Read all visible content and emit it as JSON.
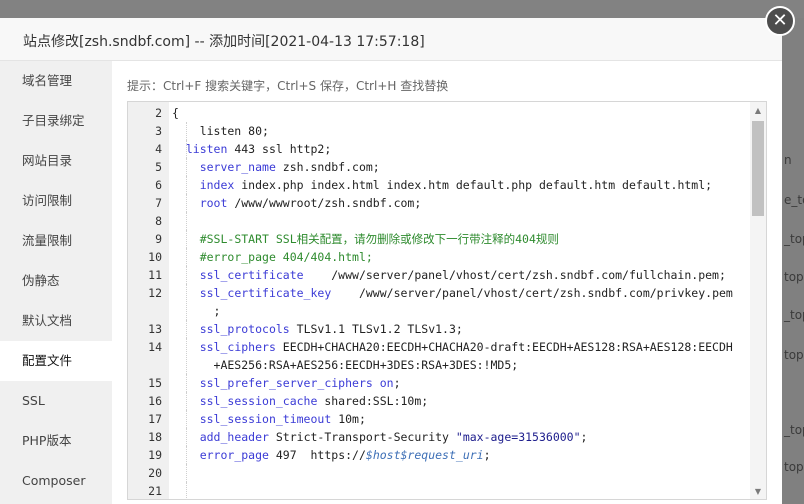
{
  "background": {
    "right_texts": [
      "n",
      "e_to",
      "_top",
      "top",
      "_top",
      "top",
      "_top",
      "top"
    ]
  },
  "dialog": {
    "title": "站点修改[zsh.sndbf.com] -- 添加时间[2021-04-13 17:57:18]",
    "close_icon": "close-icon",
    "hint": "提示：Ctrl+F 搜索关键字，Ctrl+S 保存，Ctrl+H 查找替换"
  },
  "sidebar": {
    "active_index": 7,
    "items": [
      {
        "label": "域名管理"
      },
      {
        "label": "子目录绑定"
      },
      {
        "label": "网站目录"
      },
      {
        "label": "访问限制"
      },
      {
        "label": "流量限制"
      },
      {
        "label": "伪静态"
      },
      {
        "label": "默认文档"
      },
      {
        "label": "配置文件"
      },
      {
        "label": "SSL"
      },
      {
        "label": "PHP版本"
      },
      {
        "label": "Composer"
      }
    ]
  },
  "editor": {
    "lines": [
      {
        "n": "2",
        "segs": [
          [
            "pl",
            "{"
          ]
        ]
      },
      {
        "n": "3",
        "segs": [
          [
            "pl",
            "    listen 80;"
          ]
        ]
      },
      {
        "n": "4",
        "segs": [
          [
            "pl",
            "  "
          ],
          [
            "kw",
            "listen"
          ],
          [
            "pl",
            " 443 ssl http2;"
          ]
        ]
      },
      {
        "n": "5",
        "segs": [
          [
            "pl",
            "    "
          ],
          [
            "kw",
            "server_name"
          ],
          [
            "pl",
            " zsh.sndbf.com;"
          ]
        ]
      },
      {
        "n": "6",
        "segs": [
          [
            "pl",
            "    "
          ],
          [
            "kw",
            "index"
          ],
          [
            "pl",
            " index.php index.html index.htm default.php default.htm default.html;"
          ]
        ]
      },
      {
        "n": "7",
        "segs": [
          [
            "pl",
            "    "
          ],
          [
            "kw",
            "root"
          ],
          [
            "pl",
            " /www/wwwroot/zsh.sndbf.com;"
          ]
        ]
      },
      {
        "n": "8",
        "segs": []
      },
      {
        "n": "9",
        "segs": [
          [
            "pl",
            "    "
          ],
          [
            "cm",
            "#SSL-START SSL相关配置，请勿删除或修改下一行带注释的404规则"
          ]
        ]
      },
      {
        "n": "10",
        "segs": [
          [
            "pl",
            "    "
          ],
          [
            "cm",
            "#error_page 404/404.html;"
          ]
        ]
      },
      {
        "n": "11",
        "segs": [
          [
            "pl",
            "    "
          ],
          [
            "kw",
            "ssl_certificate"
          ],
          [
            "pl",
            "    /www/server/panel/vhost/cert/zsh.sndbf.com/fullchain.pem;"
          ]
        ]
      },
      {
        "n": "12",
        "segs": [
          [
            "pl",
            "    "
          ],
          [
            "kw",
            "ssl_certificate_key"
          ],
          [
            "pl",
            "    /www/server/panel/vhost/cert/zsh.sndbf.com/privkey.pem"
          ]
        ],
        "wrap": [
          [
            "pl",
            "      ;"
          ]
        ]
      },
      {
        "n": "13",
        "segs": [
          [
            "pl",
            "    "
          ],
          [
            "kw",
            "ssl_protocols"
          ],
          [
            "pl",
            " TLSv1.1 TLSv1.2 TLSv1.3;"
          ]
        ]
      },
      {
        "n": "14",
        "segs": [
          [
            "pl",
            "    "
          ],
          [
            "kw",
            "ssl_ciphers"
          ],
          [
            "pl",
            " EECDH+CHACHA20:EECDH+CHACHA20-draft:EECDH+AES128:RSA+AES128:EECDH"
          ]
        ],
        "wrap": [
          [
            "pl",
            "      +AES256:RSA+AES256:EECDH+3DES:RSA+3DES:!MD5;"
          ]
        ]
      },
      {
        "n": "15",
        "segs": [
          [
            "pl",
            "    "
          ],
          [
            "kw",
            "ssl_prefer_server_ciphers"
          ],
          [
            "pl",
            " "
          ],
          [
            "kw",
            "on"
          ],
          [
            "pl",
            ";"
          ]
        ]
      },
      {
        "n": "16",
        "segs": [
          [
            "pl",
            "    "
          ],
          [
            "kw",
            "ssl_session_cache"
          ],
          [
            "pl",
            " shared:SSL:10m;"
          ]
        ]
      },
      {
        "n": "17",
        "segs": [
          [
            "pl",
            "    "
          ],
          [
            "kw",
            "ssl_session_timeout"
          ],
          [
            "pl",
            " 10m;"
          ]
        ]
      },
      {
        "n": "18",
        "segs": [
          [
            "pl",
            "    "
          ],
          [
            "kw",
            "add_header"
          ],
          [
            "pl",
            " Strict-Transport-Security "
          ],
          [
            "str",
            "\"max-age=31536000\""
          ],
          [
            "pl",
            ";"
          ]
        ]
      },
      {
        "n": "19",
        "segs": [
          [
            "pl",
            "    "
          ],
          [
            "kw",
            "error_page"
          ],
          [
            "pl",
            " 497  https://"
          ],
          [
            "var",
            "$host$request_uri"
          ],
          [
            "pl",
            ";"
          ]
        ]
      },
      {
        "n": "20",
        "segs": []
      },
      {
        "n": "21",
        "segs": []
      }
    ]
  }
}
